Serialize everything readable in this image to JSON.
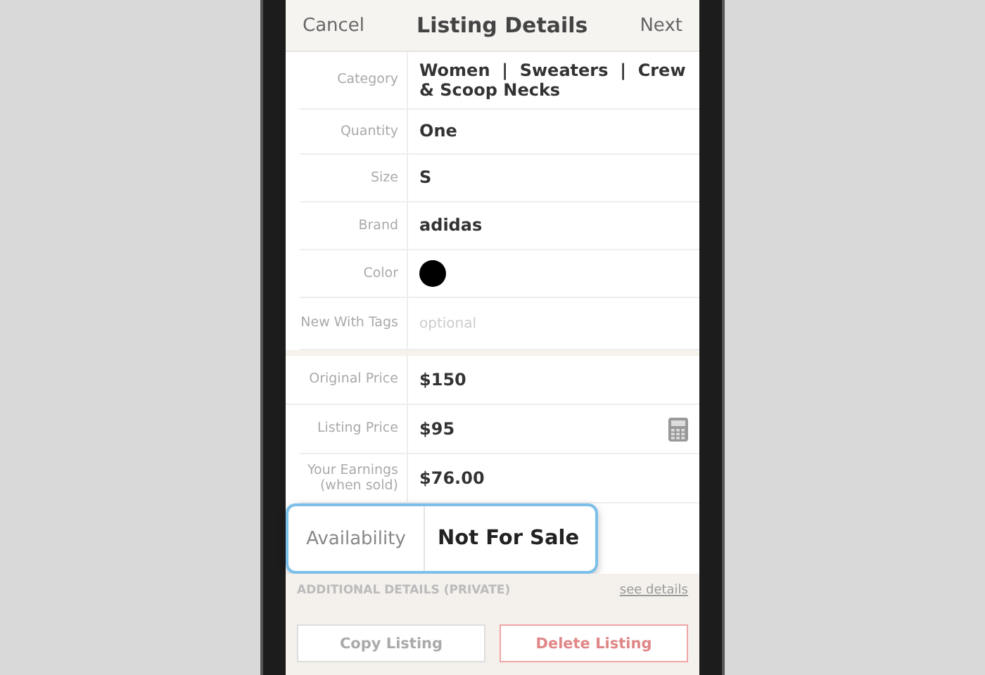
{
  "header": {
    "cancel": "Cancel",
    "title": "Listing Details",
    "next": "Next"
  },
  "details": [
    {
      "kind": "text",
      "label": "Category",
      "value": "Women  |  Sweaters  |  Crew & Scoop Necks"
    },
    {
      "kind": "text",
      "label": "Quantity",
      "value": "One"
    },
    {
      "kind": "text",
      "label": "Size",
      "value": "S"
    },
    {
      "kind": "text",
      "label": "Brand",
      "value": "adidas"
    },
    {
      "kind": "color",
      "label": "Color",
      "color": "#000000"
    },
    {
      "kind": "placeholder",
      "label": "New With Tags",
      "placeholder": "optional"
    }
  ],
  "pricing": [
    {
      "label": "Original Price",
      "value": "$150",
      "calculator": false
    },
    {
      "label": "Listing Price",
      "value": "$95",
      "calculator": true
    },
    {
      "label": "Your Earnings (when sold)",
      "value": "$76.00",
      "calculator": false
    }
  ],
  "availability": {
    "label": "Availability",
    "value": "Not For Sale"
  },
  "additional": {
    "title": "ADDITIONAL DETAILS (PRIVATE)",
    "link": "see details"
  },
  "buttons": [
    {
      "label": "Copy Listing",
      "kind": "secondary"
    },
    {
      "label": "Delete Listing",
      "kind": "danger"
    }
  ]
}
